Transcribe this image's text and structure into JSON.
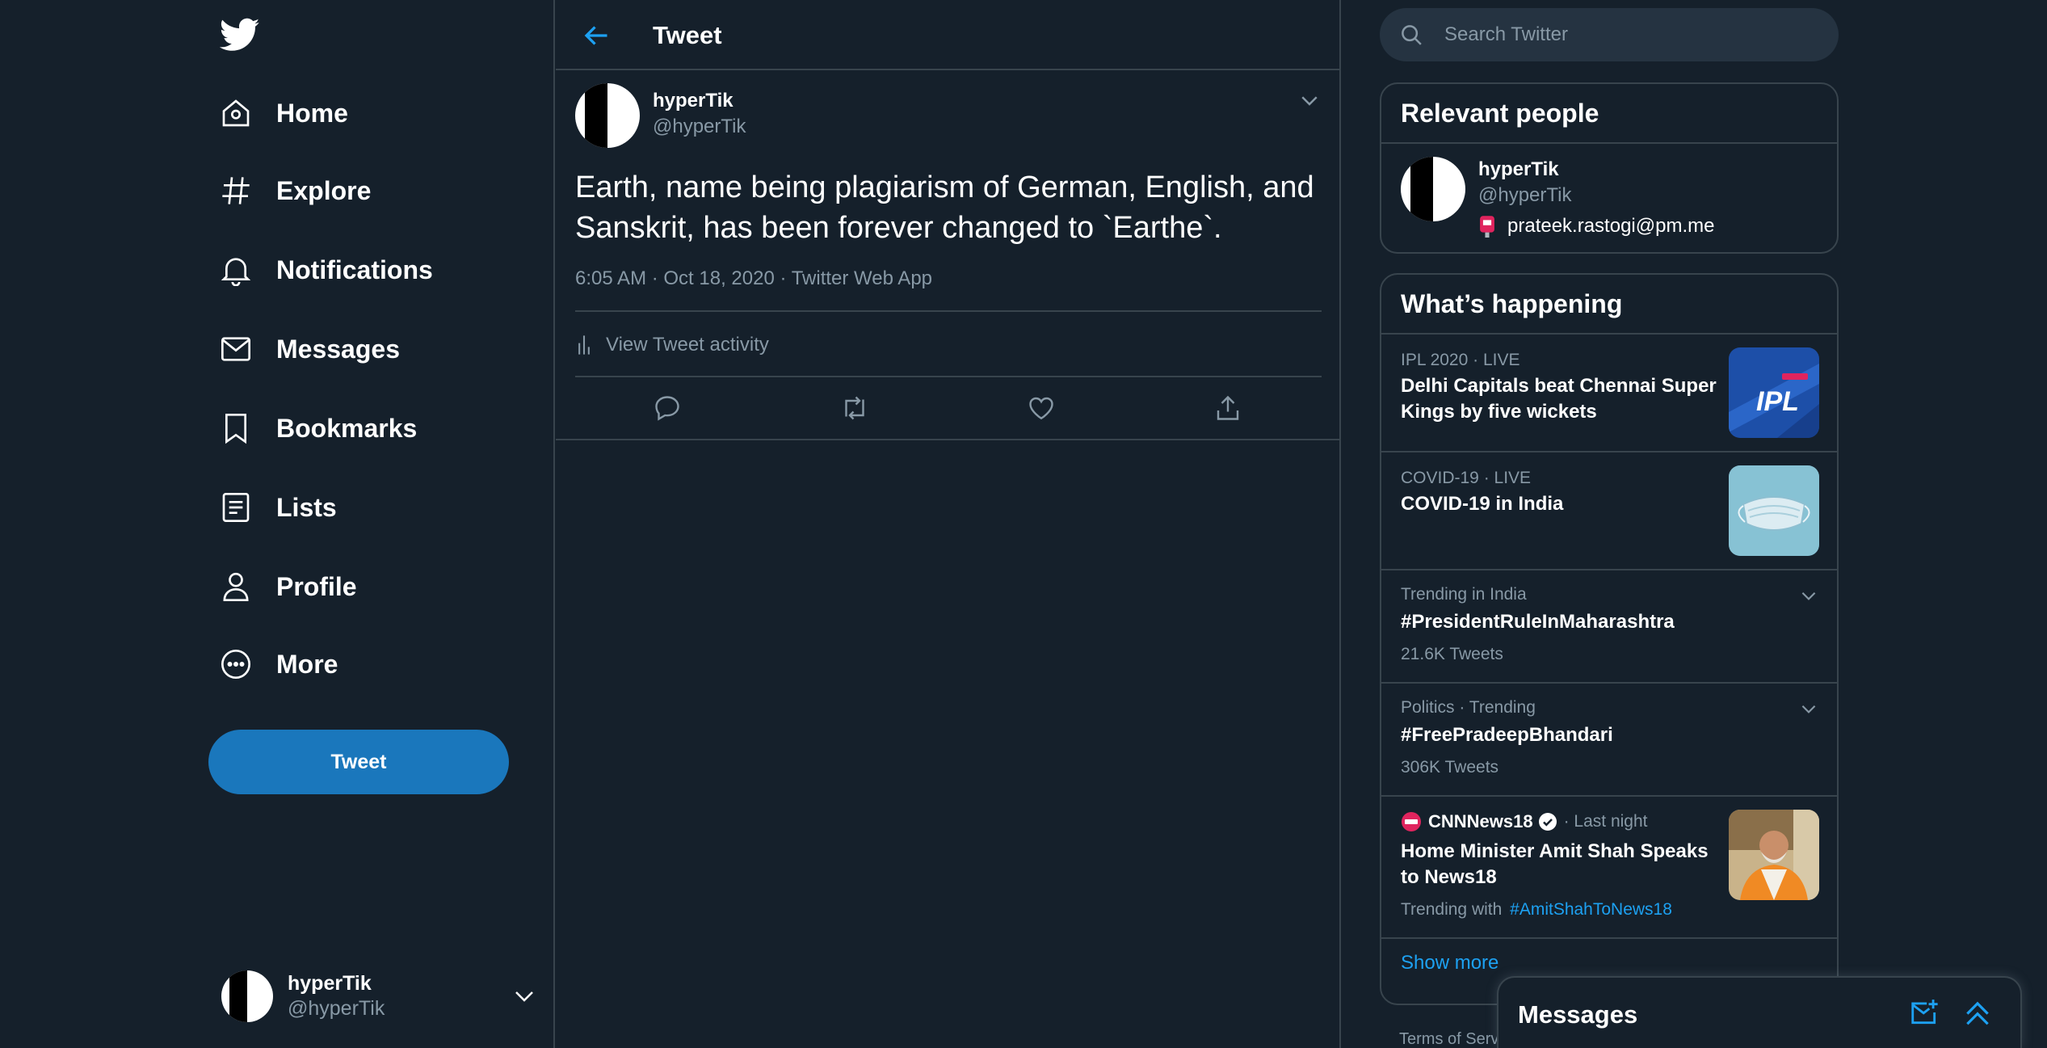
{
  "nav": {
    "items": [
      {
        "label": "Home",
        "icon": "home-icon"
      },
      {
        "label": "Explore",
        "icon": "hashtag-icon"
      },
      {
        "label": "Notifications",
        "icon": "bell-icon"
      },
      {
        "label": "Messages",
        "icon": "envelope-icon"
      },
      {
        "label": "Bookmarks",
        "icon": "bookmark-icon"
      },
      {
        "label": "Lists",
        "icon": "list-icon"
      },
      {
        "label": "Profile",
        "icon": "person-icon"
      },
      {
        "label": "More",
        "icon": "more-circle-icon"
      }
    ],
    "tweet_button": "Tweet",
    "account": {
      "name": "hyperTik",
      "handle": "@hyperTik"
    }
  },
  "main": {
    "header_title": "Tweet",
    "tweet": {
      "author_name": "hyperTik",
      "author_handle": "@hyperTik",
      "text": "Earth, name being plagiarism of German, English, and Sanskrit, has been forever changed to `Earthe`.",
      "meta": "6:05 AM · Oct 18, 2020 · Twitter Web App",
      "activity_label": "View Tweet activity"
    }
  },
  "right": {
    "search_placeholder": "Search Twitter",
    "relevant": {
      "title": "Relevant people",
      "person": {
        "name": "hyperTik",
        "handle": "@hyperTik",
        "bio": "prateek.rastogi@pm.me"
      }
    },
    "happening": {
      "title": "What’s happening",
      "trends": [
        {
          "category": "IPL 2020 · LIVE",
          "title": "Delhi Capitals beat Chennai Super Kings by five wickets"
        },
        {
          "category": "COVID-19 · LIVE",
          "title": "COVID-19 in India"
        },
        {
          "category": "Trending in India",
          "title": "#PresidentRuleInMaharashtra",
          "count": "21.6K Tweets"
        },
        {
          "category": "Politics · Trending",
          "title": "#FreePradeepBhandari",
          "count": "306K Tweets"
        },
        {
          "source": "CNNNews18",
          "time": "· Last night",
          "title": "Home Minister Amit Shah Speaks to News18",
          "trending_with": "Trending with",
          "hashtag": "#AmitShahToNews18"
        }
      ],
      "show_more": "Show more"
    },
    "terms": "Terms of Service"
  },
  "messages_drawer": {
    "title": "Messages"
  },
  "colors": {
    "accent": "#1da1f2",
    "background": "#15202b",
    "border": "#38444d",
    "muted": "#8899a6",
    "tweet_button": "#1a77bc"
  }
}
